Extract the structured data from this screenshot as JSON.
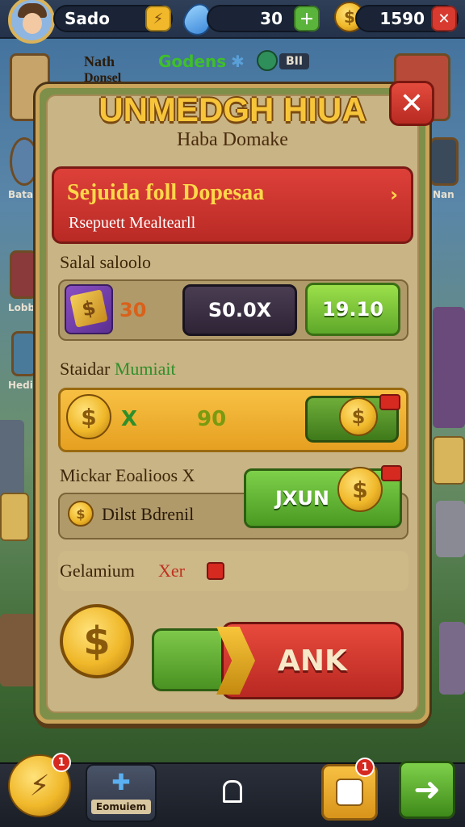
{
  "hud": {
    "player_name": "Sado",
    "gem_count": "30",
    "coin_count": "1590"
  },
  "side": {
    "left_name": "Nath",
    "left_name2": "Donsel",
    "center_label": "Godens",
    "center_value": "BII",
    "label_a": "Batan",
    "label_b": "Lobb",
    "label_c": "Hedi",
    "label_d": "Nan"
  },
  "dialog": {
    "title": "UNMEDGH HIUA",
    "subtitle": "Haba Domake",
    "banner_title": "Sejuida foll Dopesaa",
    "banner_sub": "Rsepuett Mealtearll",
    "section1_label": "Salal saloolo",
    "item_count": "30",
    "btn_mid": "S0.0X",
    "btn_right": "19.10",
    "section2_label_a": "Staidar",
    "section2_label_b": "Mumiait",
    "coin_mult": "X",
    "coin_value": "90",
    "section3_label": "Mickar Eoalioos X",
    "row3_text": "Dilst Bdrenil",
    "row3_button": "JXUN",
    "section4_label": "Gelamium",
    "section4_tag": "Xer",
    "action_button": "ANK"
  },
  "bottom": {
    "left_badge": "1",
    "center_label": "Eomuiem",
    "right_badge": "1"
  },
  "colors": {
    "gold": "#f7c53a",
    "red": "#d23a31",
    "green": "#6fb431",
    "panel": "#c9b485"
  }
}
